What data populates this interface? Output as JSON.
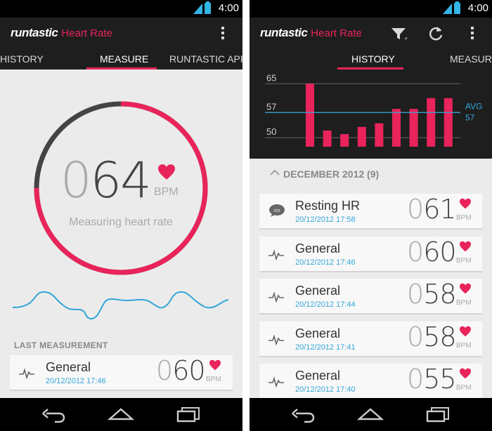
{
  "status": {
    "time": "4:00"
  },
  "icons": {
    "signal": "signal-icon",
    "battery": "battery-icon",
    "overflow": "overflow-menu-icon",
    "filter": "filter-icon",
    "refresh": "refresh-icon",
    "heart": "heart-icon",
    "pulse": "pulse-icon",
    "sleep": "sleep-bubble-icon",
    "back": "back-icon",
    "home": "home-icon",
    "recents": "recents-icon",
    "chevron": "chevron-up-icon"
  },
  "colors": {
    "accent": "#e8245a",
    "link": "#33a6d8",
    "dark_bar": "#1e1e1e",
    "ring_gray": "#555555",
    "wave": "#33a6d8"
  },
  "app": {
    "logo": "runtastic",
    "name": "Heart Rate"
  },
  "left": {
    "tabs": [
      "HISTORY",
      "MEASURE",
      "RUNTASTIC APPS"
    ],
    "active_tab": "MEASURE",
    "measurement": {
      "lead": "0",
      "digits": "64",
      "unit": "BPM",
      "status": "Measuring heart rate",
      "progress": 0.75
    },
    "last_label": "LAST MEASUREMENT",
    "last": {
      "title": "General",
      "date": "20/12/2012 17:46",
      "lead": "0",
      "digits": "60",
      "unit": "BPM"
    }
  },
  "right": {
    "tabs": [
      "HISTORY",
      "MEASURE"
    ],
    "active_tab": "HISTORY",
    "month_header": "DECEMBER 2012 (9)",
    "avg_label": "AVG",
    "avg_value": "57",
    "entries": [
      {
        "title": "Resting HR",
        "date": "20/12/2012 17:58",
        "lead": "0",
        "digits": "61",
        "unit": "BPM",
        "icon": "sleep"
      },
      {
        "title": "General",
        "date": "20/12/2012 17:46",
        "lead": "0",
        "digits": "60",
        "unit": "BPM",
        "icon": "pulse"
      },
      {
        "title": "General",
        "date": "20/12/2012 17:44",
        "lead": "0",
        "digits": "58",
        "unit": "BPM",
        "icon": "pulse"
      },
      {
        "title": "General",
        "date": "20/12/2012 17:41",
        "lead": "0",
        "digits": "58",
        "unit": "BPM",
        "icon": "pulse"
      },
      {
        "title": "General",
        "date": "20/12/2012 17:40",
        "lead": "0",
        "digits": "55",
        "unit": "BPM",
        "icon": "pulse"
      }
    ]
  },
  "chart_data": {
    "type": "bar",
    "categories": [],
    "values": [
      65,
      52,
      51,
      53,
      54,
      58,
      58,
      61,
      61
    ],
    "ylim": [
      47.5,
      67
    ],
    "yticks": [
      "65",
      "57",
      "50"
    ],
    "ytick_values": [
      65,
      57,
      50
    ],
    "reference_line": {
      "label": "AVG",
      "value": 57
    },
    "grid": true
  }
}
